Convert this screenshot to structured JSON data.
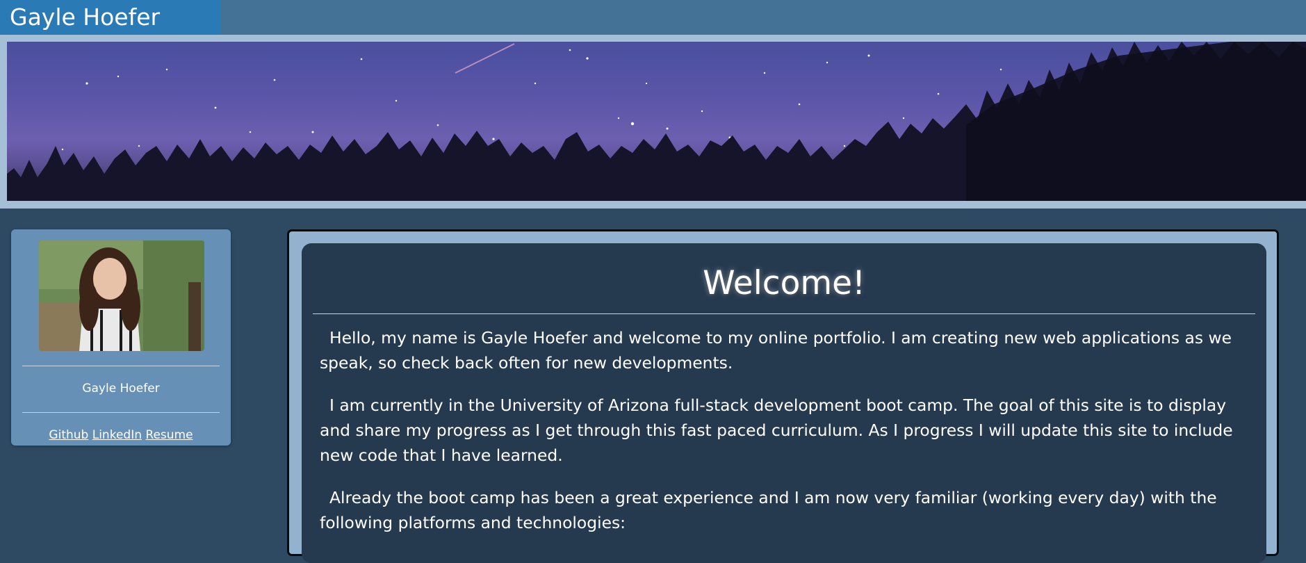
{
  "header": {
    "brand": "Gayle Hoefer"
  },
  "profile": {
    "name": "Gayle Hoefer",
    "links": [
      "Github",
      "LinkedIn",
      "Resume"
    ]
  },
  "main": {
    "heading": "Welcome!",
    "paragraphs": [
      "Hello, my name is Gayle Hoefer and welcome to my online portfolio. I am creating new web applications as we speak, so check back often for new developments.",
      "I am currently in the University of Arizona full-stack development boot camp. The goal of this site is to display and share my progress as I get through this fast paced curriculum. As I progress I will update this site to include new code that I have learned.",
      "Already the boot camp has been a great experience and I am now very familiar (working every day) with the following platforms and technologies:"
    ]
  },
  "colors": {
    "page_background": "#2e4a63",
    "topbar": "#447297",
    "brand_background": "#2a7ab5",
    "card_background": "#6690b6",
    "content_background": "#25394f",
    "content_frame": "#93b2cf"
  }
}
